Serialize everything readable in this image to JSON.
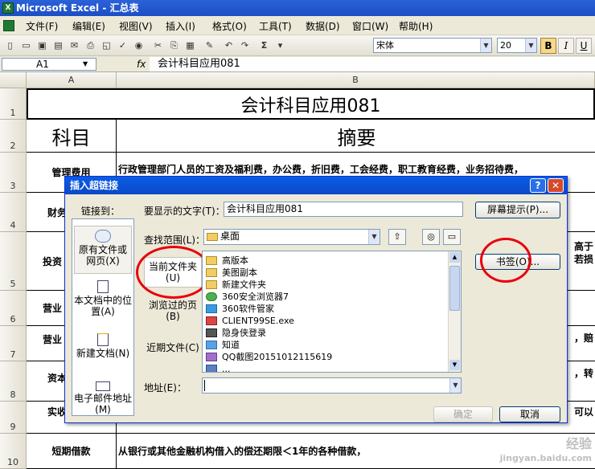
{
  "window": {
    "title": "Microsoft Excel - 汇总表"
  },
  "menu": [
    "文件(F)",
    "编辑(E)",
    "视图(V)",
    "插入(I)",
    "格式(O)",
    "工具(T)",
    "数据(D)",
    "窗口(W)",
    "帮助(H)"
  ],
  "toolbar": {
    "font_name": "宋体",
    "font_size": "20",
    "bold": "B",
    "italic": "I",
    "underline": "U",
    "sigma": "Σ"
  },
  "formula_bar": {
    "cell_ref": "A1",
    "fx": "fx",
    "content": "会计科目应用081"
  },
  "columns": [
    "A",
    "B"
  ],
  "rows": [
    {
      "num": "1",
      "a": "",
      "b": "会计科目应用081"
    },
    {
      "num": "2",
      "a": "科目",
      "b": "摘要"
    },
    {
      "num": "3",
      "a": "管理费用",
      "b": "行政管理部门人员的工资及福利费，办公费，折旧费，工会经费，职工教育经费，业务招待费，"
    },
    {
      "num": "4",
      "a": "财务",
      "b": ""
    },
    {
      "num": "5",
      "a": "投资",
      "b": "高于",
      "b2": "若损"
    },
    {
      "num": "6",
      "a": "营业",
      "b": ""
    },
    {
      "num": "7",
      "a": "营业",
      "b": "，赔"
    },
    {
      "num": "8",
      "a": "资本",
      "b": "，转"
    },
    {
      "num": "9",
      "a": "实收",
      "b": "可以"
    },
    {
      "num": "10",
      "a": "短期借款",
      "b": "从银行或其他金融机构借入的偿还期限＜1年的各种借款，"
    },
    {
      "num": "11",
      "a": "",
      "b": ""
    }
  ],
  "dialog": {
    "title": "插入超链接",
    "help_btn": "?",
    "close_btn": "✕",
    "link_to_label": "链接到：",
    "display_text_label": "要显示的文字(T)：",
    "display_text_value": "会计科目应用081",
    "screen_tip_btn": "屏幕提示(P)...",
    "look_in_label": "查找范围(L)：",
    "look_in_value": "桌面",
    "bookmark_btn": "书签(O)...",
    "address_label": "地址(E)：",
    "address_value": "",
    "ok_btn": "确定",
    "cancel_btn": "取消",
    "sidebar": [
      {
        "label": "原有文件或网页(X)",
        "icon": "globe-page-icon"
      },
      {
        "label": "本文档中的位置(A)",
        "icon": "document-location-icon"
      },
      {
        "label": "新建文档(N)",
        "icon": "new-document-icon"
      },
      {
        "label": "电子邮件地址(M)",
        "icon": "email-icon"
      }
    ],
    "scopes": [
      {
        "label": "当前文件夹(U)"
      },
      {
        "label": "浏览过的页(B)"
      },
      {
        "label": "近期文件(C)"
      }
    ],
    "files": [
      {
        "name": "高版本",
        "icon": "folder-icon"
      },
      {
        "name": "美图副本",
        "icon": "folder-icon"
      },
      {
        "name": "新建文件夹",
        "icon": "folder-icon"
      },
      {
        "name": "360安全浏览器7",
        "icon": "shortcut-icon"
      },
      {
        "name": "360软件管家",
        "icon": "shortcut-icon"
      },
      {
        "name": "CLIENT99SE.exe",
        "icon": "exe-icon"
      },
      {
        "name": "隐身侠登录",
        "icon": "shortcut-icon"
      },
      {
        "name": "知道",
        "icon": "shortcut-icon"
      },
      {
        "name": "QQ截图20151012115619",
        "icon": "image-icon"
      },
      {
        "name": "...",
        "icon": "file-icon"
      }
    ]
  },
  "watermark": {
    "line1": "经验",
    "line2": "jingyan.baidu.com"
  }
}
